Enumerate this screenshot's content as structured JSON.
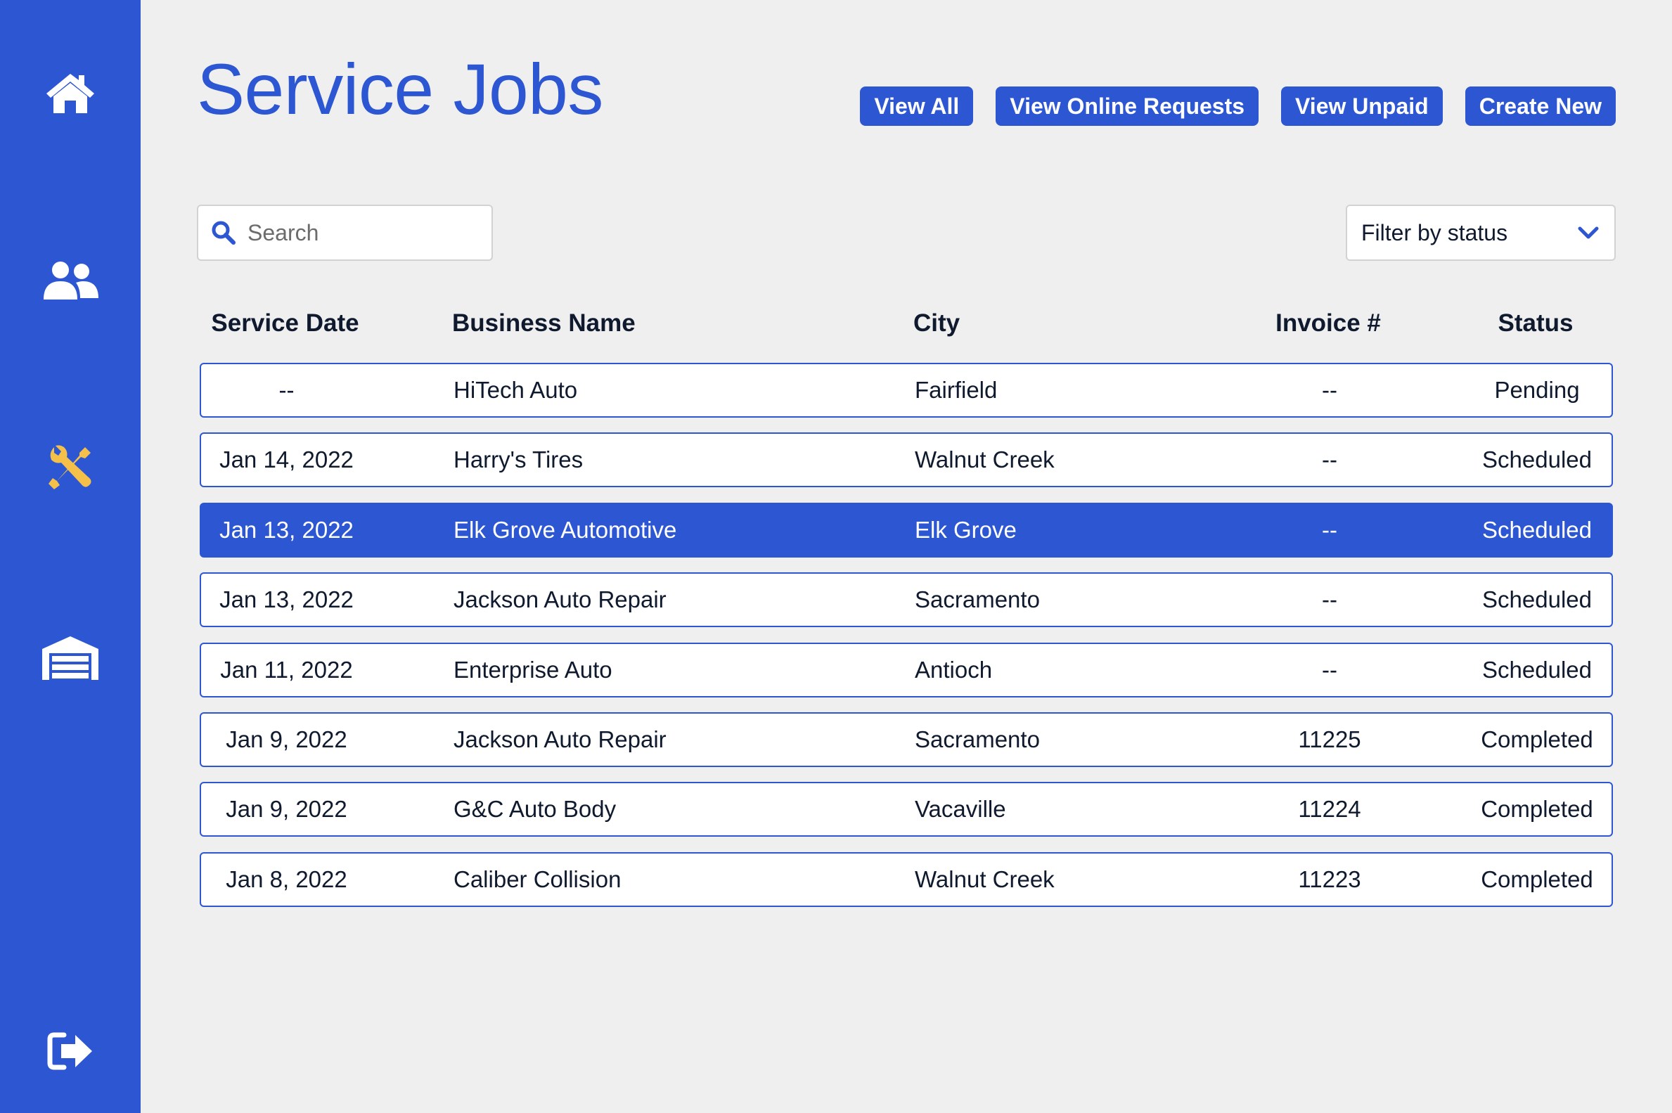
{
  "sidebar": {
    "items": [
      {
        "name": "home",
        "icon": "home-icon"
      },
      {
        "name": "customers",
        "icon": "users-icon"
      },
      {
        "name": "service-jobs",
        "icon": "tools-icon",
        "active": true
      },
      {
        "name": "garage",
        "icon": "garage-icon"
      },
      {
        "name": "logout",
        "icon": "sign-out-icon"
      }
    ],
    "colors": {
      "background": "#2d56d3",
      "icon": "#ffffff",
      "active_icon": "#f5c04a"
    }
  },
  "header": {
    "title": "Service Jobs",
    "buttons": {
      "view_all": "View All",
      "view_online_requests": "View Online Requests",
      "view_unpaid": "View Unpaid",
      "create_new": "Create New"
    }
  },
  "search": {
    "placeholder": "Search",
    "value": ""
  },
  "filter": {
    "label": "Filter by status"
  },
  "table": {
    "columns": {
      "service_date": "Service Date",
      "business_name": "Business Name",
      "city": "City",
      "invoice": "Invoice #",
      "status": "Status"
    },
    "rows": [
      {
        "date": "--",
        "business": "HiTech Auto",
        "city": "Fairfield",
        "invoice": "--",
        "status": "Pending"
      },
      {
        "date": "Jan 14, 2022",
        "business": "Harry's Tires",
        "city": "Walnut Creek",
        "invoice": "--",
        "status": "Scheduled"
      },
      {
        "date": "Jan 13, 2022",
        "business": "Elk Grove Automotive",
        "city": "Elk Grove",
        "invoice": "--",
        "status": "Scheduled",
        "selected": true
      },
      {
        "date": "Jan 13, 2022",
        "business": "Jackson Auto Repair",
        "city": "Sacramento",
        "invoice": "--",
        "status": "Scheduled"
      },
      {
        "date": "Jan 11, 2022",
        "business": "Enterprise Auto",
        "city": "Antioch",
        "invoice": "--",
        "status": "Scheduled"
      },
      {
        "date": "Jan 9, 2022",
        "business": "Jackson Auto Repair",
        "city": "Sacramento",
        "invoice": "11225",
        "status": "Completed"
      },
      {
        "date": "Jan 9, 2022",
        "business": "G&C Auto Body",
        "city": "Vacaville",
        "invoice": "11224",
        "status": "Completed"
      },
      {
        "date": "Jan 8, 2022",
        "business": "Caliber Collision",
        "city": "Walnut Creek",
        "invoice": "11223",
        "status": "Completed"
      }
    ]
  },
  "colors": {
    "accent": "#2d56d3",
    "page_background": "#efefef"
  }
}
